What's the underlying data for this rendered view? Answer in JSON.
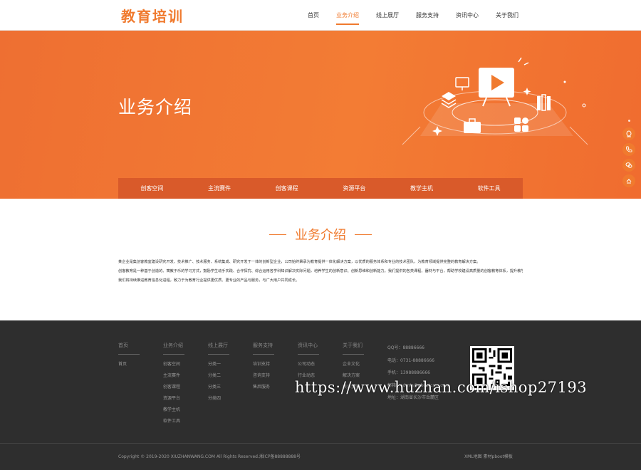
{
  "header": {
    "logo": "教育培训",
    "nav": [
      "首页",
      "业务介绍",
      "线上展厅",
      "服务支持",
      "资讯中心",
      "关于我们"
    ],
    "active_nav": 1
  },
  "banner": {
    "title": "业务介绍",
    "subnav": [
      "创客空间",
      "主流赛件",
      "创客课程",
      "资源平台",
      "教学主机",
      "软件工具"
    ]
  },
  "section": {
    "title": "业务介绍",
    "paragraphs": [
      "某企业是集创客教室建设研究开发、技术推广、技术服务、系统集成、研究开发于一体的创新型企业，公司始终秉承为教育提供一体化解决方案，以优质的服务体系和专业的技术团队，为教育领域提供完整的教育解决方案。",
      "创客教育是一种基于创造的、寓教于乐的学习方式，鼓励学生动手实践、合作探究、综合运用各学科知识解决实际问题，培养学生的创新意识、创新思维和创新能力。我们提供的各类课程、器材与平台，帮助学校建设高质量的创客教育体系，提升教学质量和学生综合素养。",
      "我们将持续推进教育信息化进程，致力于为教育行业提供更优质、更专业的产品与服务，与广大用户共同成长。"
    ]
  },
  "footer": {
    "columns": [
      {
        "title": "首页",
        "links": [
          "首页"
        ]
      },
      {
        "title": "业务介绍",
        "links": [
          "创客空间",
          "主流赛件",
          "创客课程",
          "资源平台",
          "教学主机",
          "软件工具"
        ]
      },
      {
        "title": "线上展厅",
        "links": [
          "分类一",
          "分类二",
          "分类三",
          "分类四"
        ]
      },
      {
        "title": "服务支持",
        "links": [
          "培训支持",
          "咨询支持",
          "售后服务"
        ]
      },
      {
        "title": "资讯中心",
        "links": [
          "公司动态",
          "行业动态"
        ]
      },
      {
        "title": "关于我们",
        "links": [
          "企业文化",
          "解决方案",
          "联系我们"
        ]
      }
    ],
    "contact": {
      "qq": "QQ号：88886666",
      "phone": "电话：0731-88886666",
      "mobile": "手机：13988886666",
      "email": "邮箱：admin@pbootcms.com",
      "address": "地址：湖南省长沙市岳麓区"
    },
    "copyright": "Copyright © 2019-2020 XIUZHANWANG.COM All Rights Reserved.湘ICP备88888888号",
    "links": "XML地图 素材pboot模板"
  },
  "watermark": "https://www.huzhan.com/ishop27193",
  "colors": {
    "accent": "#f07a2e",
    "banner_bar": "#d95a2a",
    "footer_bg": "#2e2e2e"
  }
}
